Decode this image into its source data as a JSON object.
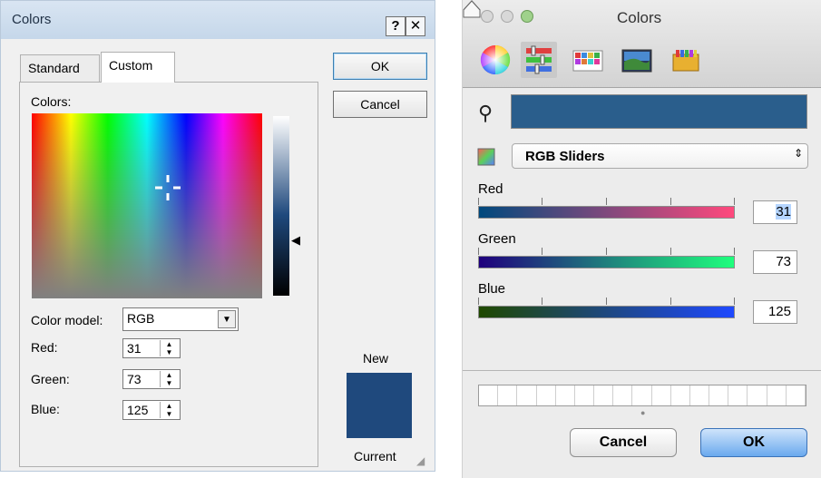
{
  "windows_dialog": {
    "title": "Colors",
    "help_button": "?",
    "close_button": "✕",
    "tabs": [
      "Standard",
      "Custom"
    ],
    "active_tab": "Custom",
    "colors_label": "Colors:",
    "color_model_label": "Color model:",
    "color_model_value": "RGB",
    "red_label": "Red:",
    "green_label": "Green:",
    "blue_label": "Blue:",
    "red": "31",
    "green": "73",
    "blue": "125",
    "ok_label": "OK",
    "cancel_label": "Cancel",
    "new_label": "New",
    "current_label": "Current",
    "preview_color": "#1f497d"
  },
  "mac_panel": {
    "title": "Colors",
    "modes": [
      "color-wheel",
      "color-sliders",
      "color-palettes",
      "image-palettes",
      "crayons"
    ],
    "active_mode": "color-sliders",
    "swatch_color": "#2a5e8c",
    "slider_mode": "RGB Sliders",
    "sliders": [
      {
        "label": "Red",
        "value": "31",
        "fraction": 0.12
      },
      {
        "label": "Green",
        "value": "73",
        "fraction": 0.29
      },
      {
        "label": "Blue",
        "value": "125",
        "fraction": 0.49
      }
    ],
    "cancel_label": "Cancel",
    "ok_label": "OK"
  }
}
